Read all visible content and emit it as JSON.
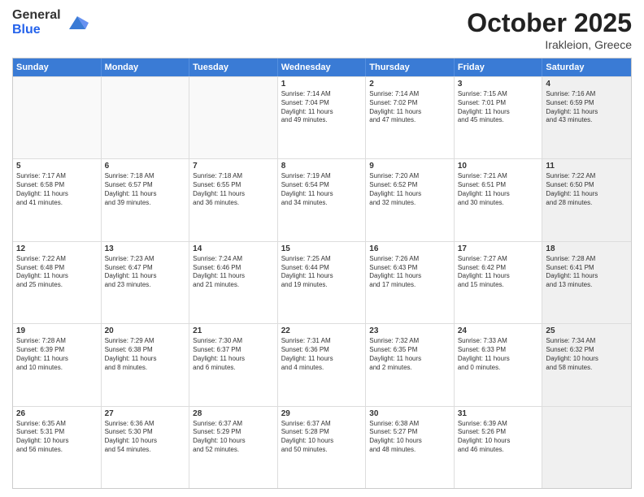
{
  "header": {
    "logo_general": "General",
    "logo_blue": "Blue",
    "month": "October 2025",
    "location": "Irakleion, Greece"
  },
  "days_of_week": [
    "Sunday",
    "Monday",
    "Tuesday",
    "Wednesday",
    "Thursday",
    "Friday",
    "Saturday"
  ],
  "rows": [
    [
      {
        "day": "",
        "text": "",
        "empty": true
      },
      {
        "day": "",
        "text": "",
        "empty": true
      },
      {
        "day": "",
        "text": "",
        "empty": true
      },
      {
        "day": "1",
        "text": "Sunrise: 7:14 AM\nSunset: 7:04 PM\nDaylight: 11 hours\nand 49 minutes."
      },
      {
        "day": "2",
        "text": "Sunrise: 7:14 AM\nSunset: 7:02 PM\nDaylight: 11 hours\nand 47 minutes."
      },
      {
        "day": "3",
        "text": "Sunrise: 7:15 AM\nSunset: 7:01 PM\nDaylight: 11 hours\nand 45 minutes."
      },
      {
        "day": "4",
        "text": "Sunrise: 7:16 AM\nSunset: 6:59 PM\nDaylight: 11 hours\nand 43 minutes.",
        "shaded": true
      }
    ],
    [
      {
        "day": "5",
        "text": "Sunrise: 7:17 AM\nSunset: 6:58 PM\nDaylight: 11 hours\nand 41 minutes."
      },
      {
        "day": "6",
        "text": "Sunrise: 7:18 AM\nSunset: 6:57 PM\nDaylight: 11 hours\nand 39 minutes."
      },
      {
        "day": "7",
        "text": "Sunrise: 7:18 AM\nSunset: 6:55 PM\nDaylight: 11 hours\nand 36 minutes."
      },
      {
        "day": "8",
        "text": "Sunrise: 7:19 AM\nSunset: 6:54 PM\nDaylight: 11 hours\nand 34 minutes."
      },
      {
        "day": "9",
        "text": "Sunrise: 7:20 AM\nSunset: 6:52 PM\nDaylight: 11 hours\nand 32 minutes."
      },
      {
        "day": "10",
        "text": "Sunrise: 7:21 AM\nSunset: 6:51 PM\nDaylight: 11 hours\nand 30 minutes."
      },
      {
        "day": "11",
        "text": "Sunrise: 7:22 AM\nSunset: 6:50 PM\nDaylight: 11 hours\nand 28 minutes.",
        "shaded": true
      }
    ],
    [
      {
        "day": "12",
        "text": "Sunrise: 7:22 AM\nSunset: 6:48 PM\nDaylight: 11 hours\nand 25 minutes."
      },
      {
        "day": "13",
        "text": "Sunrise: 7:23 AM\nSunset: 6:47 PM\nDaylight: 11 hours\nand 23 minutes."
      },
      {
        "day": "14",
        "text": "Sunrise: 7:24 AM\nSunset: 6:46 PM\nDaylight: 11 hours\nand 21 minutes."
      },
      {
        "day": "15",
        "text": "Sunrise: 7:25 AM\nSunset: 6:44 PM\nDaylight: 11 hours\nand 19 minutes."
      },
      {
        "day": "16",
        "text": "Sunrise: 7:26 AM\nSunset: 6:43 PM\nDaylight: 11 hours\nand 17 minutes."
      },
      {
        "day": "17",
        "text": "Sunrise: 7:27 AM\nSunset: 6:42 PM\nDaylight: 11 hours\nand 15 minutes."
      },
      {
        "day": "18",
        "text": "Sunrise: 7:28 AM\nSunset: 6:41 PM\nDaylight: 11 hours\nand 13 minutes.",
        "shaded": true
      }
    ],
    [
      {
        "day": "19",
        "text": "Sunrise: 7:28 AM\nSunset: 6:39 PM\nDaylight: 11 hours\nand 10 minutes."
      },
      {
        "day": "20",
        "text": "Sunrise: 7:29 AM\nSunset: 6:38 PM\nDaylight: 11 hours\nand 8 minutes."
      },
      {
        "day": "21",
        "text": "Sunrise: 7:30 AM\nSunset: 6:37 PM\nDaylight: 11 hours\nand 6 minutes."
      },
      {
        "day": "22",
        "text": "Sunrise: 7:31 AM\nSunset: 6:36 PM\nDaylight: 11 hours\nand 4 minutes."
      },
      {
        "day": "23",
        "text": "Sunrise: 7:32 AM\nSunset: 6:35 PM\nDaylight: 11 hours\nand 2 minutes."
      },
      {
        "day": "24",
        "text": "Sunrise: 7:33 AM\nSunset: 6:33 PM\nDaylight: 11 hours\nand 0 minutes."
      },
      {
        "day": "25",
        "text": "Sunrise: 7:34 AM\nSunset: 6:32 PM\nDaylight: 10 hours\nand 58 minutes.",
        "shaded": true
      }
    ],
    [
      {
        "day": "26",
        "text": "Sunrise: 6:35 AM\nSunset: 5:31 PM\nDaylight: 10 hours\nand 56 minutes."
      },
      {
        "day": "27",
        "text": "Sunrise: 6:36 AM\nSunset: 5:30 PM\nDaylight: 10 hours\nand 54 minutes."
      },
      {
        "day": "28",
        "text": "Sunrise: 6:37 AM\nSunset: 5:29 PM\nDaylight: 10 hours\nand 52 minutes."
      },
      {
        "day": "29",
        "text": "Sunrise: 6:37 AM\nSunset: 5:28 PM\nDaylight: 10 hours\nand 50 minutes."
      },
      {
        "day": "30",
        "text": "Sunrise: 6:38 AM\nSunset: 5:27 PM\nDaylight: 10 hours\nand 48 minutes."
      },
      {
        "day": "31",
        "text": "Sunrise: 6:39 AM\nSunset: 5:26 PM\nDaylight: 10 hours\nand 46 minutes."
      },
      {
        "day": "",
        "text": "",
        "empty": true,
        "shaded": true
      }
    ]
  ]
}
